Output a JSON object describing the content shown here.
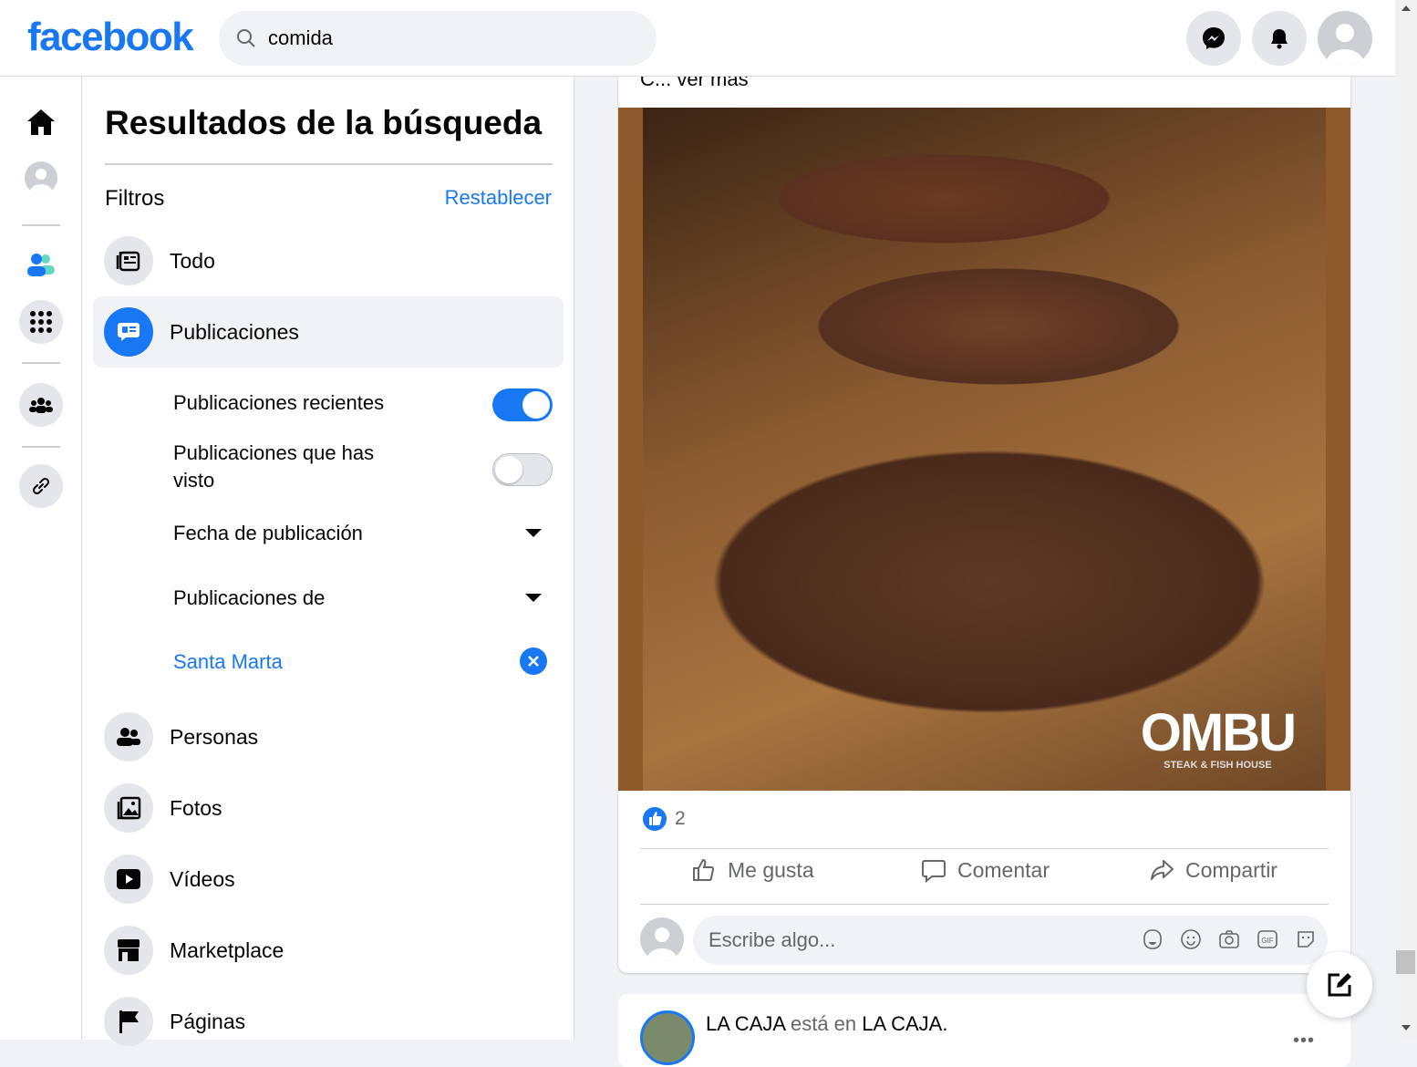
{
  "header": {
    "logo": "facebook",
    "search_value": "comida"
  },
  "panel": {
    "title": "Resultados de la búsqueda",
    "filters_label": "Filtros",
    "reset_label": "Restablecer",
    "items": [
      {
        "label": "Todo"
      },
      {
        "label": "Publicaciones"
      },
      {
        "label": "Personas"
      },
      {
        "label": "Fotos"
      },
      {
        "label": "Vídeos"
      },
      {
        "label": "Marketplace"
      },
      {
        "label": "Páginas"
      }
    ],
    "sub": {
      "recent": "Publicaciones recientes",
      "recent_on": true,
      "seen": "Publicaciones que has visto",
      "seen_on": false,
      "date": "Fecha de publicación",
      "from": "Publicaciones de",
      "location": "Santa Marta"
    }
  },
  "post": {
    "see_more": "C... ver más",
    "image_logo": "OMBU",
    "image_logo_sub": "STEAK & FISH HOUSE",
    "like_count": "2",
    "like": "Me gusta",
    "comment": "Comentar",
    "share": "Compartir",
    "comment_placeholder": "Escribe algo..."
  },
  "post2": {
    "author": "LA CAJA",
    "verb": "está en",
    "place": "LA CAJA",
    "period": "."
  },
  "colors": {
    "accent": "#1877f2"
  }
}
